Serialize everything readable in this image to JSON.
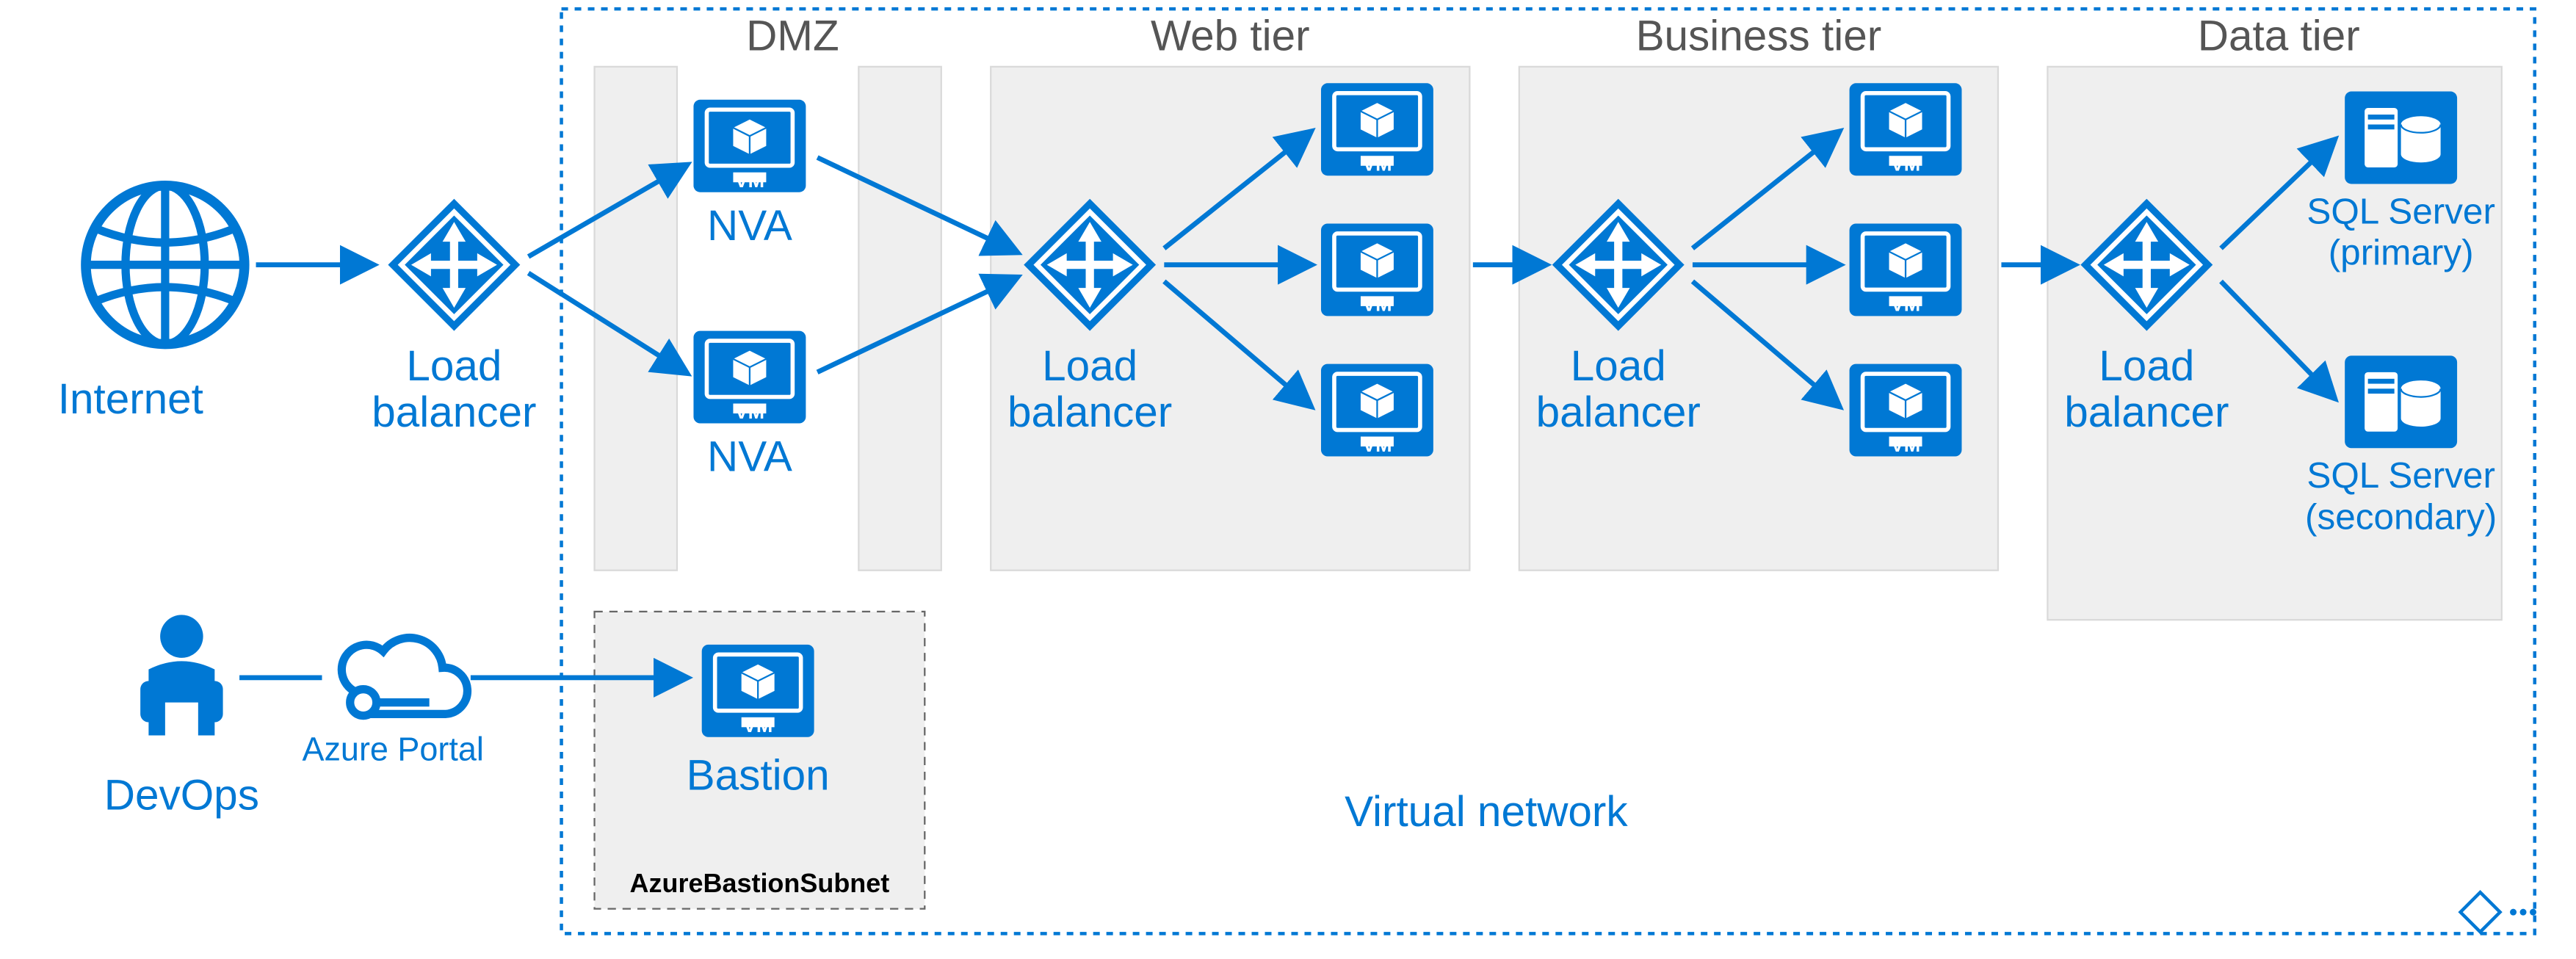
{
  "labels": {
    "internet": "Internet",
    "lb": "Load\nbalancer",
    "devops": "DevOps",
    "azureportal": "Azure Portal",
    "bastion": "Bastion",
    "bastionsubnet": "AzureBastionSubnet",
    "vnet": "Virtual network",
    "nva": "NVA",
    "sqlprimary": "SQL Server\n(primary)",
    "sqlsecondary": "SQL Server\n(secondary)",
    "vm": "VM"
  },
  "tiers": {
    "dmz": "DMZ",
    "web": "Web tier",
    "business": "Business tier",
    "data": "Data tier"
  },
  "colors": {
    "azure": "#0078d4",
    "panel": "#efefef",
    "panelstroke": "#d9d9d9"
  }
}
